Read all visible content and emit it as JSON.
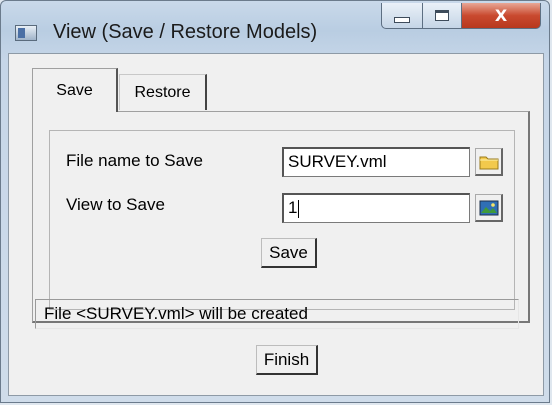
{
  "window": {
    "title": "View (Save / Restore Models)",
    "close_glyph": "X"
  },
  "tabs": [
    {
      "label": "Save",
      "selected": true
    },
    {
      "label": "Restore",
      "selected": false
    }
  ],
  "save_tab": {
    "file_name_label": "File name to Save",
    "file_name_value": "SURVEY.vml",
    "view_label": "View to Save",
    "view_value": "1",
    "save_button": "Save",
    "icons": {
      "file_browse": "folder-icon",
      "view_select": "view-picture-icon"
    }
  },
  "status_text": "File <SURVEY.vml> will be created",
  "finish_button": "Finish",
  "colors": {
    "close_button": "#c94a2f",
    "folder": "#f2c94c"
  }
}
